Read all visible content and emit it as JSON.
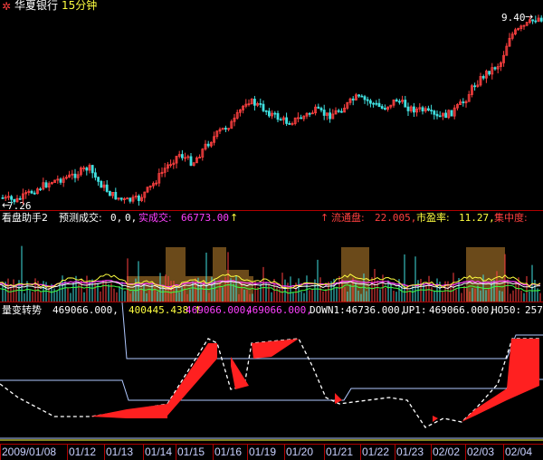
{
  "title": {
    "stock_name": "华夏银行",
    "period": "15分钟"
  },
  "price_pane": {
    "high_label": "9.40",
    "low_label": "7.26",
    "colors": {
      "up": "#ff4040",
      "down": "#40e0e0",
      "ma": "#ffffff"
    }
  },
  "indicator_pane": {
    "name": "看盘助手2",
    "forecast_label": "预测成交:",
    "forecast_value": "0,",
    "forecast_value2": "0,",
    "actual_label": "实成交:",
    "actual_value": "66773.00",
    "float_label": "流通盘:",
    "float_value": "22.005,",
    "pe_label": "市盈率:",
    "pe_value": "11.27,",
    "concentration_label": "集中度:",
    "arrow1": "↑",
    "arrow2": "↑",
    "colors": {
      "name": "#ffffff",
      "forecast": "#ffffff",
      "actual": "#ff40ff",
      "float": "#ff4040",
      "pe": "#ffff40",
      "conc": "#ff4040"
    }
  },
  "volume_pane": {
    "name": "量变转势",
    "v1": "469066.000,",
    "v2": "400445.438",
    "arrow": "↑",
    "v3": "469066.000,",
    "v4": "469066.000,",
    "down_label": "DOWN1:",
    "down_value": "46736.000,",
    "up_label": "UP1:",
    "up_value": "469066.000,",
    "ho_label": "HO50:",
    "ho_value": "257",
    "colors": {
      "name": "#ffffff",
      "v1": "#ffffff",
      "v2": "#ffff40",
      "v3": "#ff40ff",
      "v4": "#ff40ff",
      "rest": "#ffffff"
    }
  },
  "dates": [
    "2009/01/08",
    "01/12",
    "01/13",
    "01/14",
    "01/15",
    "01/16",
    "01/19",
    "01/20",
    "01/21",
    "01/22",
    "01/23",
    "02/02",
    "02/03",
    "02/04"
  ]
}
